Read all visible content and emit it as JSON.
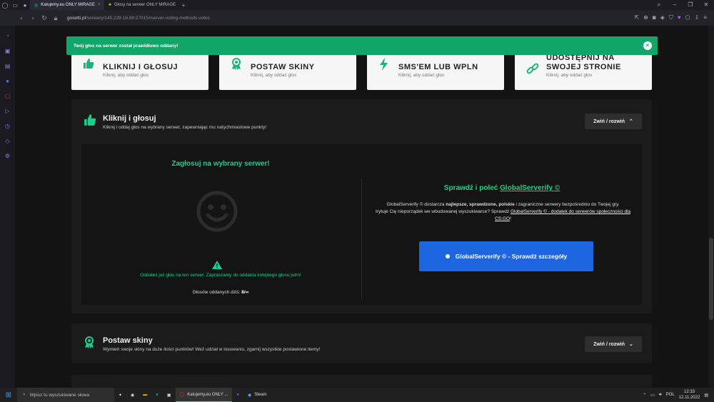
{
  "browser": {
    "tabs": [
      {
        "label": "Katujemy.eu ONLY MIRAGE",
        "active": true
      },
      {
        "label": "Głosy na serwer ONLY MIRAGE",
        "active": false
      }
    ],
    "new_tab": "+",
    "url_host": "gosetti.pl",
    "url_path": "/serwery/145.239.16.89:27015#server-voting-methods-votes"
  },
  "toast": {
    "message": "Twój głos na serwer został prawidłowo oddany!",
    "close": "×"
  },
  "cards": [
    {
      "title_lines": [
        "KLIKNIJ I GŁOSUJ"
      ],
      "sub": "Kliknij, aby oddać głos",
      "icon": "thumbs-up-icon"
    },
    {
      "title_lines": [
        "POSTAW SKINY"
      ],
      "sub": "Kliknij, aby oddać głos",
      "icon": "award-icon"
    },
    {
      "title_lines": [
        "SMS'EM LUB WPLN"
      ],
      "sub": "Kliknij, aby oddać głos",
      "icon": "bolt-icon"
    },
    {
      "title_lines": [
        "UDOSTĘPNIJ NA",
        "SWOJEJ STRONIE"
      ],
      "sub": "Kliknij, aby oddać głos",
      "icon": "link-icon"
    }
  ],
  "panel_vote": {
    "title": "Kliknij i głosuj",
    "subtitle": "Kliknij i oddaj głos na wybrany serwer, zapewniając mu natychmiastowe punkty!",
    "toggle": "Zwiń / rozwiń",
    "vote_title": "Zagłosuj na wybrany serwer!",
    "vote_message": "Oddałeś już głos na ten serwer. Zapraszamy do oddania kolejnego głosu jutro!",
    "vote_count_label": "Głosów oddanych dziś:",
    "vote_count_value": "8/∞",
    "gs_title_prefix": "Sprawdź i poleć",
    "gs_title_link": "GlobalServerify ©",
    "gs_text_1": "GlobalServerify © dostarcza",
    "gs_text_bold": "najlepsze, sprawdzone, polskie",
    "gs_text_2": "i zagraniczne serwery bezpośrednio do Twojej gry.",
    "gs_text_3": "Irytuje Cię nieporządek we wbudowanej wyszukiwarce? Sprawdź",
    "gs_text_link": "GlobalServerify © - dodatek do serwerów społeczności dla CS:GO",
    "gs_text_end": "!",
    "gs_button": "GlobalServerify © - Sprawdź szczegóły"
  },
  "panel_skins": {
    "title": "Postaw skiny",
    "subtitle": "Wymień swoje skiny na duże ilości punktów! Weź udział w losowaniu, zgarnij wszystkie postawione itemy!",
    "toggle": "Zwiń / rozwiń"
  },
  "taskbar": {
    "search_placeholder": "Wpisz tu wyszukiwane słowa",
    "apps": [
      {
        "label": "Katujemy.eu ONLY ...",
        "active": true
      },
      {
        "label": "Steam",
        "active": false
      }
    ],
    "lang": "POL",
    "time": "12:33",
    "date": "12.11.2022"
  }
}
